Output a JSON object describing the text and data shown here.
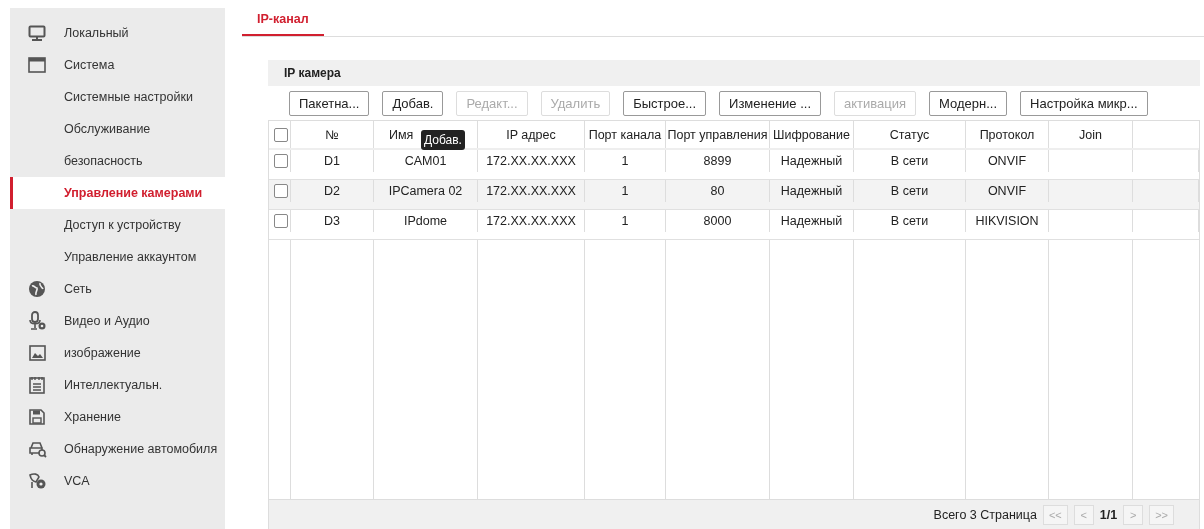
{
  "sidebar": {
    "items": [
      {
        "label": "Локальный",
        "selected": false
      },
      {
        "label": "Система",
        "selected": false,
        "children": [
          {
            "label": "Системные настройки",
            "selected": false
          },
          {
            "label": "Обслуживание",
            "selected": false
          },
          {
            "label": "безопасность",
            "selected": false
          },
          {
            "label": "Управление камерами",
            "selected": true
          },
          {
            "label": "Доступ к устройству",
            "selected": false
          },
          {
            "label": "Управление аккаунтом",
            "selected": false
          }
        ]
      },
      {
        "label": "Сеть",
        "selected": false
      },
      {
        "label": "Видео и Аудио",
        "selected": false
      },
      {
        "label": "изображение",
        "selected": false
      },
      {
        "label": "Интеллектуальн.",
        "selected": false
      },
      {
        "label": "Хранение",
        "selected": false
      },
      {
        "label": "Обнаружение автомобиля",
        "selected": false
      },
      {
        "label": "VCA",
        "selected": false
      }
    ]
  },
  "tabs": [
    {
      "label": "IP-канал",
      "selected": true
    }
  ],
  "panel": {
    "title": "IP камера",
    "buttons": [
      {
        "label": "Пакетна...",
        "disabled": false
      },
      {
        "label": "Добав.",
        "disabled": false
      },
      {
        "label": "Редакт...",
        "disabled": true
      },
      {
        "label": "Удалить",
        "disabled": true
      },
      {
        "label": "Быстрое...",
        "disabled": false
      },
      {
        "label": "Изменение ...",
        "disabled": false
      },
      {
        "label": "активация",
        "disabled": true
      },
      {
        "label": "Модерн...",
        "disabled": false
      },
      {
        "label": "Настройка микр...",
        "disabled": false
      }
    ],
    "table": {
      "select_all_checked": false,
      "columns": [
        {
          "label": "№"
        },
        {
          "label": "Имя",
          "tooltip": "Добав."
        },
        {
          "label": "IP адрес"
        },
        {
          "label": "Порт канала"
        },
        {
          "label": "Порт управления"
        },
        {
          "label": "Шифрование"
        },
        {
          "label": "Статус"
        },
        {
          "label": "Протокол"
        },
        {
          "label": "Join"
        }
      ],
      "rows": [
        {
          "checked": false,
          "highlighted": false,
          "cells": [
            "D1",
            "CAM01",
            "172.XX.XX.XXX",
            "1",
            "8899",
            "Надежный",
            "В сети",
            "ONVIF"
          ]
        },
        {
          "checked": false,
          "highlighted": true,
          "cells": [
            "D2",
            "IPCamera 02",
            "172.XX.XX.XXX",
            "1",
            "80",
            "Надежный",
            "В сети",
            "ONVIF"
          ]
        },
        {
          "checked": false,
          "highlighted": false,
          "cells": [
            "D3",
            "IPdome",
            "172.XX.XX.XXX",
            "1",
            "8000",
            "Надежный",
            "В сети",
            "HIKVISION"
          ]
        }
      ]
    },
    "pager": {
      "summary": "Всего 3 Страница",
      "first": "<<",
      "prev": "<",
      "page": "1/1",
      "next": ">",
      "last": ">>"
    }
  }
}
